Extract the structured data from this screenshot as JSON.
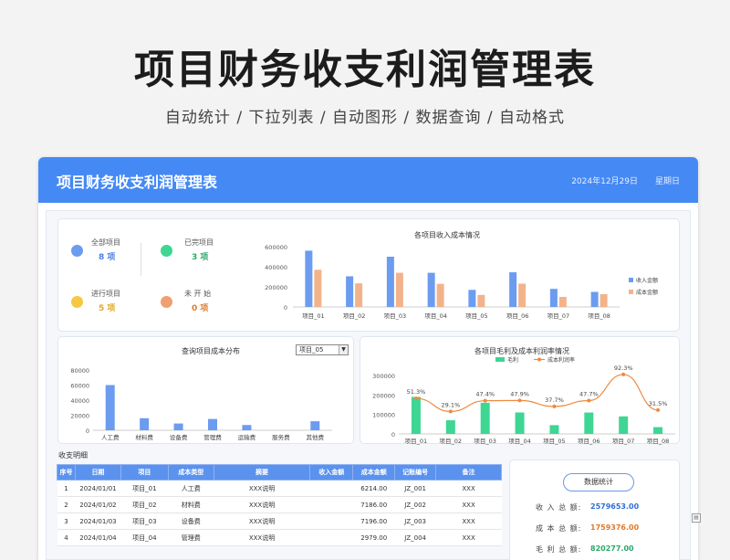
{
  "hero": {
    "title": "项目财务收支利润管理表",
    "subtitle": "自动统计  /  下拉列表  /  自动图形  /  数据查询  /  自动格式"
  },
  "header": {
    "title": "项目财务收支利润管理表",
    "date": "2024年12月29日",
    "weekday": "星期日"
  },
  "colors": {
    "accent": "#4589f5",
    "income": "#6b9cf0",
    "cost": "#f3b38a",
    "profit": "#3ed693",
    "rate": "#ee8a3e"
  },
  "kpis": [
    {
      "label": "全部项目",
      "value": "8 项",
      "color": "#6b9cf0",
      "icon": "circle-blue"
    },
    {
      "label": "已完项目",
      "value": "3 项",
      "color": "#3ed693",
      "icon": "circle-green"
    },
    {
      "label": "进行项目",
      "value": "5 项",
      "color": "#f5c842",
      "icon": "circle-yellow"
    },
    {
      "label": "未 开 始",
      "value": "0 项",
      "color": "#f0a070",
      "icon": "circle-orange"
    }
  ],
  "section_label": "收支明细",
  "select": {
    "value": "项目_05"
  },
  "chart_data": [
    {
      "type": "bar",
      "title": "各项目收入成本情况",
      "categories": [
        "项目_01",
        "项目_02",
        "项目_03",
        "项目_04",
        "项目_05",
        "项目_06",
        "项目_07",
        "项目_08"
      ],
      "series": [
        {
          "name": "收入金额",
          "values": [
            560000,
            305000,
            500000,
            340000,
            170000,
            345000,
            180000,
            150000
          ]
        },
        {
          "name": "成本金额",
          "values": [
            370000,
            235000,
            340000,
            230000,
            120000,
            232000,
            100000,
            128000
          ]
        }
      ],
      "ylim": [
        0,
        600000
      ],
      "yticks": [
        "0",
        "200000",
        "400000",
        "600000"
      ],
      "legend": "right"
    },
    {
      "type": "bar",
      "title": "查询项目成本分布",
      "categories": [
        "人工费",
        "材料费",
        "设备费",
        "管理费",
        "运输费",
        "服务费",
        "其他费"
      ],
      "values": [
        60000,
        16000,
        9000,
        15000,
        7000,
        0,
        12000
      ],
      "ylim": [
        0,
        80000
      ],
      "yticks": [
        "0",
        "20000",
        "40000",
        "60000",
        "80000"
      ]
    },
    {
      "type": "bar",
      "title": "各项目毛利及成本利润率情况",
      "categories": [
        "项目_01",
        "项目_02",
        "项目_03",
        "项目_04",
        "项目_05",
        "项目_06",
        "项目_07",
        "项目_08"
      ],
      "series": [
        {
          "name": "毛利",
          "values": [
            190000,
            70000,
            160000,
            110000,
            45000,
            110000,
            90000,
            35000
          ]
        },
        {
          "name": "成本利润率",
          "values": [
            51.3,
            29.1,
            47.4,
            47.9,
            37.7,
            47.7,
            92.3,
            31.5
          ]
        }
      ],
      "rate_labels": [
        "51.3%",
        "29.1%",
        "47.4%",
        "47.9%",
        "37.7%",
        "47.7%",
        "92.3%",
        "31.5%"
      ],
      "ylim": [
        0,
        300000
      ],
      "yticks": [
        "0",
        "100000",
        "200000",
        "300000"
      ],
      "legend": "top"
    }
  ],
  "table": {
    "headers": [
      "序号",
      "日期",
      "项目",
      "成本类型",
      "摘要",
      "收入金额",
      "成本金额",
      "记账编号",
      "备注"
    ],
    "rows": [
      [
        "1",
        "2024/01/01",
        "项目_01",
        "人工费",
        "XXX说明",
        "",
        "6214.00",
        "JZ_001",
        "XXX"
      ],
      [
        "2",
        "2024/01/02",
        "项目_02",
        "材料费",
        "XXX说明",
        "",
        "7186.00",
        "JZ_002",
        "XXX"
      ],
      [
        "3",
        "2024/01/03",
        "项目_03",
        "设备费",
        "XXX说明",
        "",
        "7196.00",
        "JZ_003",
        "XXX"
      ],
      [
        "4",
        "2024/01/04",
        "项目_04",
        "管理费",
        "XXX说明",
        "",
        "2979.00",
        "JZ_004",
        "XXX"
      ]
    ]
  },
  "stats": {
    "button": "数据统计",
    "rows": [
      {
        "label": "收 入 总 额:",
        "value": "2579653.00",
        "color": "#2f6fd6"
      },
      {
        "label": "成 本 总 额:",
        "value": "1759376.00",
        "color": "#e07a2a"
      },
      {
        "label": "毛 利 总 额:",
        "value": "820277.00",
        "color": "#2aa86a"
      }
    ]
  }
}
